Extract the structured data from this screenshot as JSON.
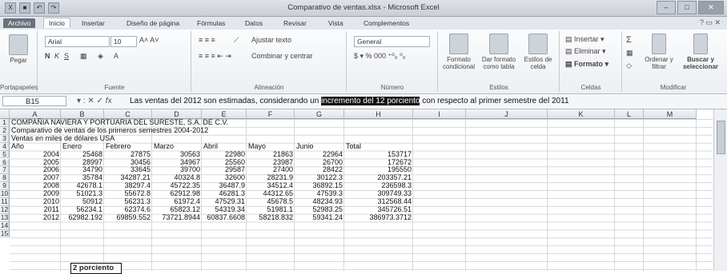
{
  "window": {
    "title": "Comparativo de ventas.xlsx - Microsoft Excel"
  },
  "tabs": [
    "Archivo",
    "Inicio",
    "Insertar",
    "Diseño de página",
    "Fórmulas",
    "Datos",
    "Revisar",
    "Vista",
    "Complementos"
  ],
  "ribbon": {
    "paste": "Pegar",
    "clipboard": "Portapapeles",
    "font_name": "Arial",
    "font_size": "10",
    "font_group": "Fuente",
    "wrap": "Ajustar texto",
    "merge": "Combinar y centrar",
    "align_group": "Alineación",
    "number_format": "General",
    "number_group": "Número",
    "cond_format": "Formato condicional",
    "format_table": "Dar formato como tabla",
    "cell_styles": "Estilos de celda",
    "styles_group": "Estilos",
    "insert": "Insertar",
    "delete": "Eliminar",
    "format": "Formato",
    "cells_group": "Celdas",
    "sort": "Ordenar y filtrar",
    "find": "Buscar y seleccionar",
    "modify_group": "Modificar"
  },
  "formula_bar": {
    "cell_ref": "B15",
    "before": "Las ventas del 2012 son estimadas, considerando un ",
    "highlight": "incremento del 12 porciento",
    "after": " con respecto al primer semestre del 2011"
  },
  "columns": [
    "A",
    "B",
    "C",
    "D",
    "E",
    "F",
    "G",
    "H",
    "I",
    "J",
    "K",
    "L",
    "M"
  ],
  "rows": [
    "1",
    "2",
    "3",
    "4",
    "5",
    "6",
    "7",
    "8",
    "9",
    "10",
    "11",
    "12",
    "13",
    "14",
    "15"
  ],
  "sheet": {
    "r1": "COMPAÑIA NAVIERA Y PORTUARIA DEL SURESTE, S.A. DE C.V.",
    "r2": "Comparativo de ventas de los primeros semestres 2004-2012",
    "r3": "Ventas en miles de dólares USA",
    "header": [
      "Año",
      "Enero",
      "Febrero",
      "Marzo",
      "Abril",
      "Mayo",
      "Junio",
      "Total"
    ],
    "data": [
      [
        "2004",
        "25468",
        "27875",
        "30563",
        "22980",
        "21863",
        "22964",
        "153717"
      ],
      [
        "2005",
        "28997",
        "30456",
        "34967",
        "25560",
        "23987",
        "26700",
        "172672"
      ],
      [
        "2006",
        "34790",
        "33645",
        "39700",
        "29587",
        "27400",
        "28422",
        "195550"
      ],
      [
        "2007",
        "35784",
        "34287.21",
        "40324.8",
        "32600",
        "28231.9",
        "30122.3",
        "203357.21"
      ],
      [
        "2008",
        "42678.1",
        "38297.4",
        "45722.35",
        "36487.9",
        "34512.4",
        "36892.15",
        "236598.3"
      ],
      [
        "2009",
        "51021.3",
        "55672.8",
        "62912.98",
        "46281.3",
        "44312.65",
        "47539.3",
        "309749.33"
      ],
      [
        "2010",
        "50912",
        "56231.3",
        "61972.4",
        "47529.31",
        "45678.5",
        "48234.93",
        "312568.44"
      ],
      [
        "2011",
        "56234.1",
        "62374.6",
        "65823.12",
        "54319.34",
        "51981.1",
        "52983.25",
        "345726.51"
      ],
      [
        "2012",
        "62982.192",
        "69859.552",
        "73721.8944",
        "60837.6608",
        "58218.832",
        "59341.24",
        "386973.3712"
      ]
    ],
    "r15_partial": "2 porciento"
  }
}
